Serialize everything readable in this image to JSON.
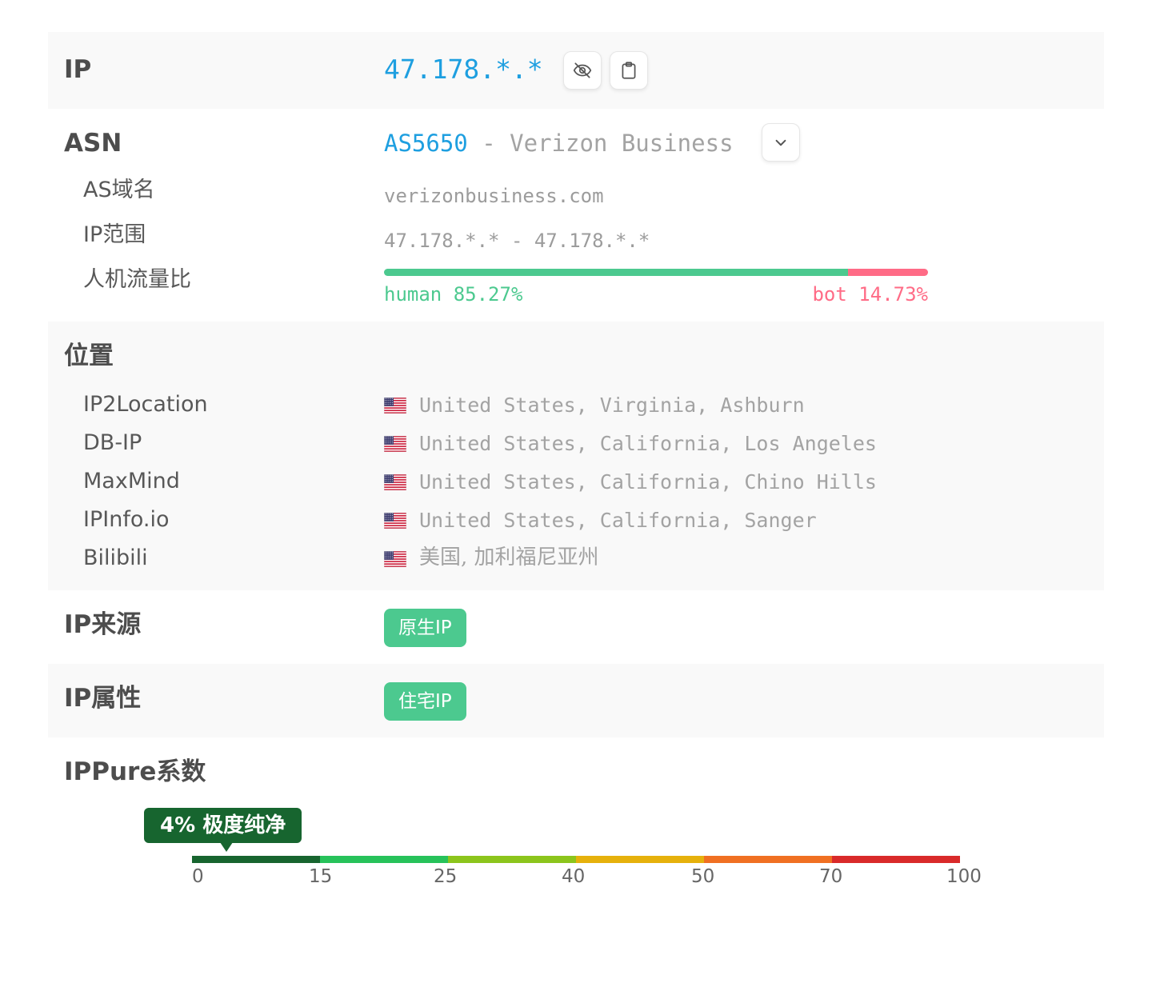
{
  "ip": {
    "label": "IP",
    "value": "47.178.*.*",
    "value_color": "#1e9fe0",
    "hide_icon": "eye-off-icon",
    "copy_icon": "clipboard-icon"
  },
  "asn": {
    "label": "ASN",
    "number": "AS5650",
    "separator": "-",
    "name": "Verizon Business",
    "expand_icon": "chevron-down-icon",
    "domain_label": "AS域名",
    "domain": "verizonbusiness.com",
    "range_label": "IP范围",
    "range": "47.178.*.* - 47.178.*.*",
    "ratio_label": "人机流量比",
    "human_label": "human",
    "human_value": "85.27%",
    "human_fraction": 0.8527,
    "bot_label": "bot",
    "bot_value": "14.73%",
    "human_color": "#4cc98f",
    "bot_color": "#ff6b86"
  },
  "location": {
    "label": "位置",
    "flag_icon": "us-flag-icon",
    "sources": [
      {
        "name": "IP2Location",
        "value": "United States, Virginia, Ashburn"
      },
      {
        "name": "DB-IP",
        "value": "United States, California, Los Angeles"
      },
      {
        "name": "MaxMind",
        "value": "United States, California, Chino Hills"
      },
      {
        "name": "IPInfo.io",
        "value": "United States, California, Sanger"
      },
      {
        "name": "Bilibili",
        "value": "美国, 加利福尼亚州"
      }
    ]
  },
  "source": {
    "label": "IP来源",
    "badge": "原生IP"
  },
  "attribute": {
    "label": "IP属性",
    "badge": "住宅IP"
  },
  "purity": {
    "label": "IPPure系数",
    "indicator": "4% 极度纯净",
    "score": 4,
    "ticks": [
      "0",
      "15",
      "25",
      "40",
      "50",
      "70",
      "100"
    ],
    "segment_colors": [
      "#17652f",
      "#27c25a",
      "#8cc51c",
      "#e6b10c",
      "#f07022",
      "#d92a2a"
    ]
  },
  "badge_color": "#4cc98f"
}
